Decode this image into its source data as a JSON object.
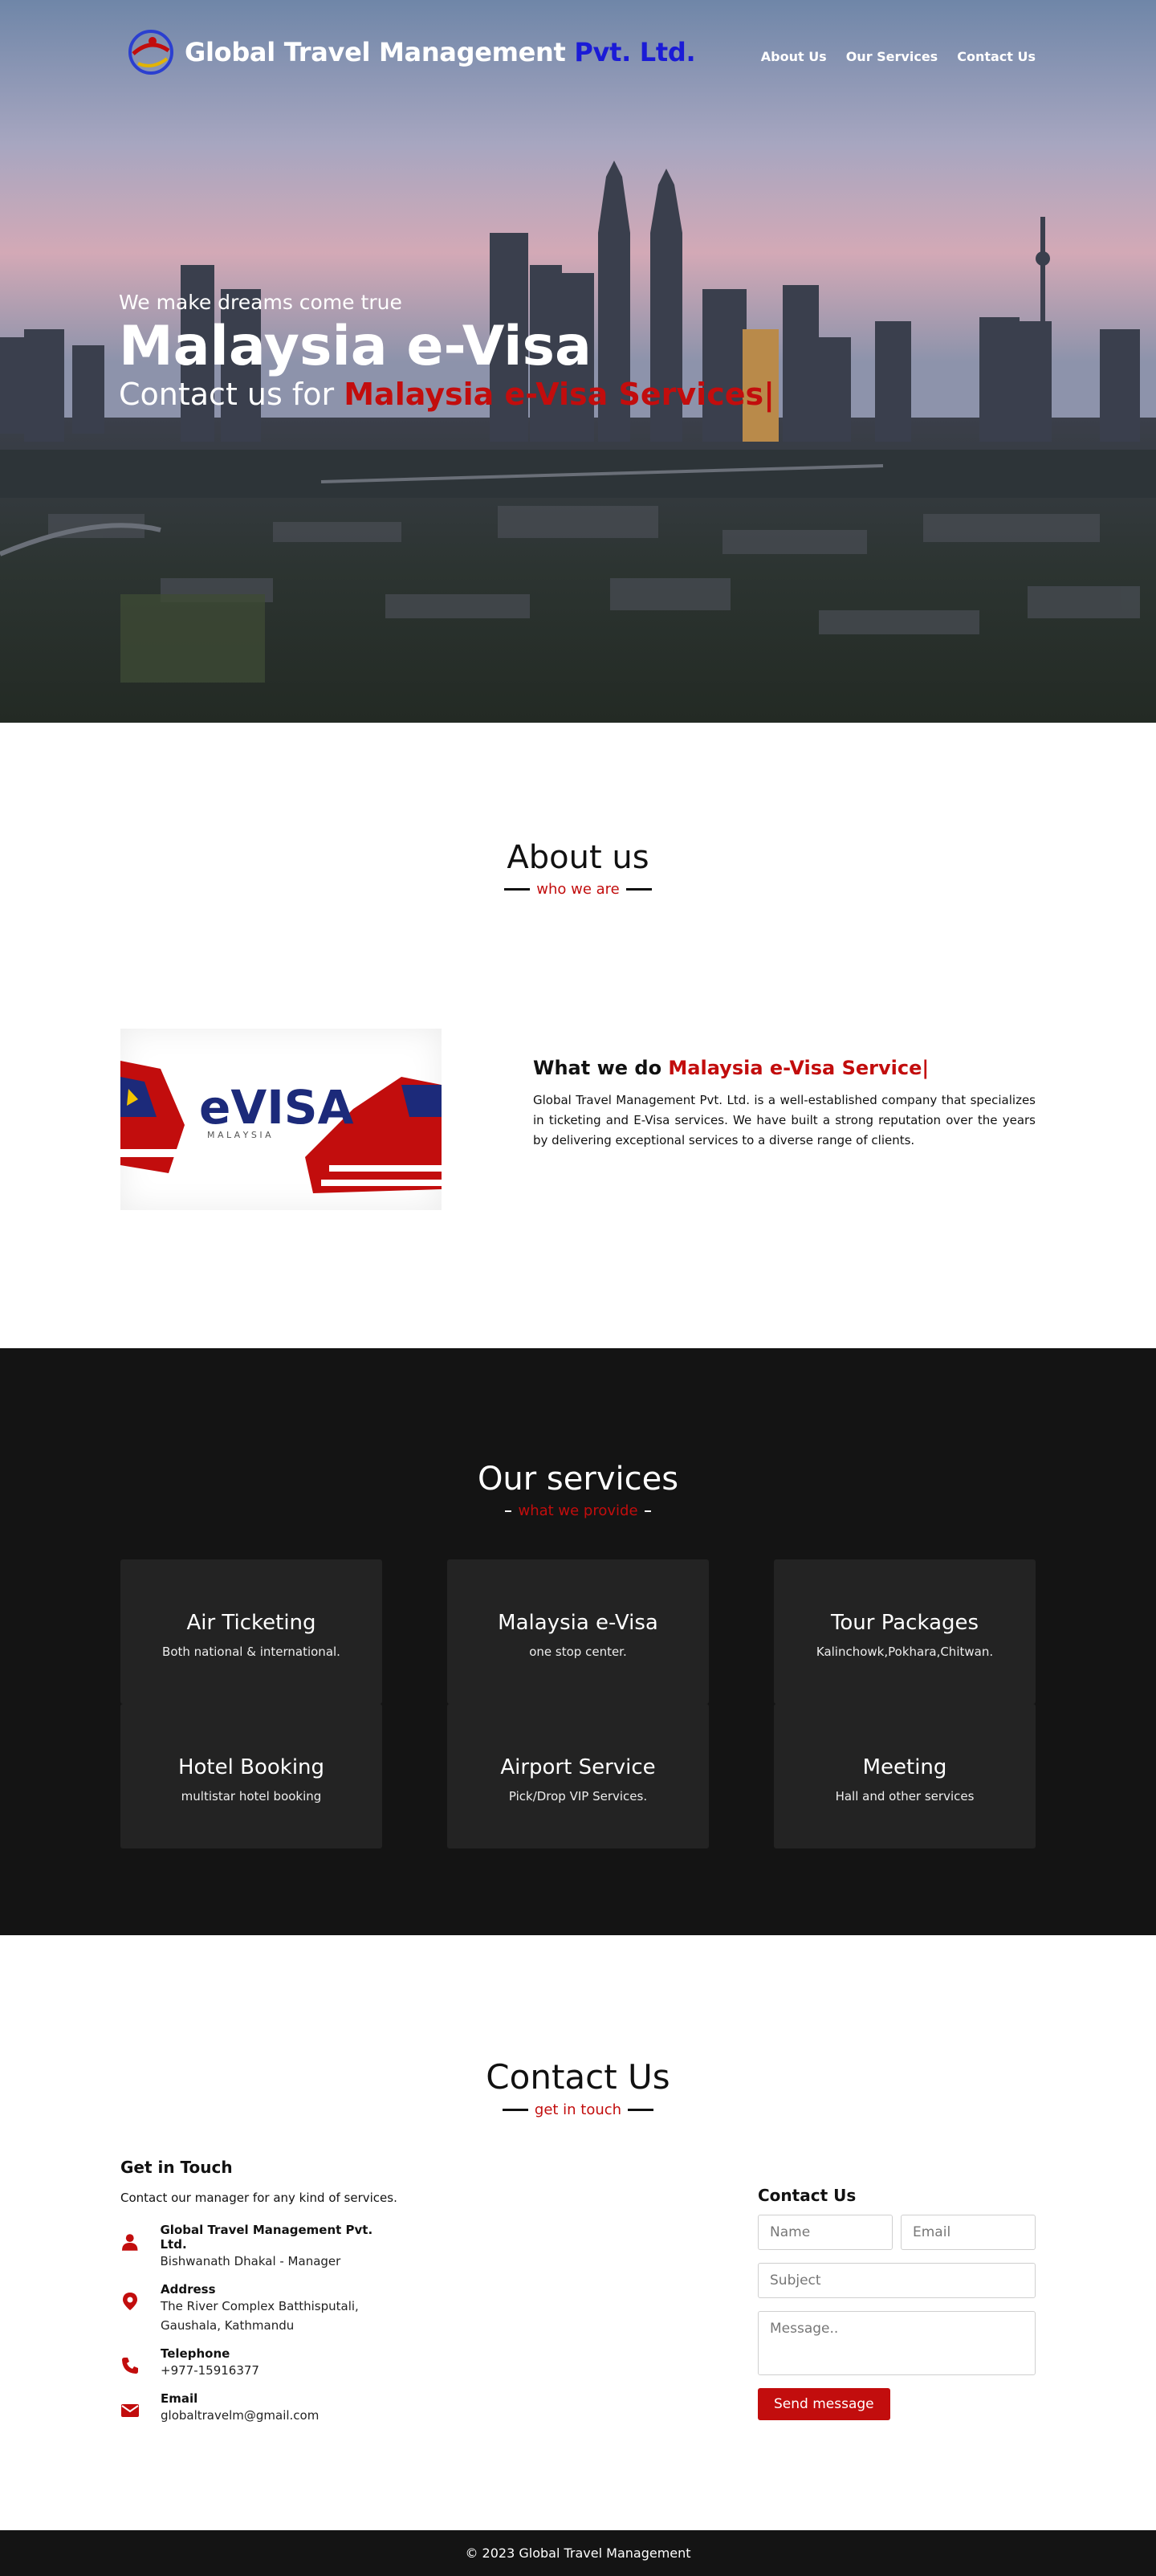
{
  "header": {
    "brand_main": "Global Travel Management",
    "brand_accent": "Pvt. Ltd.",
    "nav": [
      "About Us",
      "Our Services",
      "Contact Us"
    ]
  },
  "hero": {
    "subtitle": "We make dreams come true",
    "title": "Malaysia e-Visa",
    "line_prefix": "Contact us for",
    "line_highlight": "Malaysia e-Visa Services|"
  },
  "about": {
    "heading": "About us",
    "tag": "who we are",
    "image_title": "eVISA",
    "image_sub": "M A L A Y S I A",
    "what_prefix": "What we do",
    "what_highlight": "Malaysia e-Visa Service|",
    "body": "Global Travel Management Pvt. Ltd. is a well-established company that specializes in ticketing and E-Visa services. We have built a strong reputation over the years by delivering exceptional services to a diverse range of clients."
  },
  "services": {
    "heading": "Our services",
    "tag": "what we provide",
    "items": [
      {
        "title": "Air Ticketing",
        "desc": "Both national & international."
      },
      {
        "title": "Malaysia e-Visa",
        "desc": "one stop center."
      },
      {
        "title": "Tour Packages",
        "desc": "Kalinchowk,Pokhara,Chitwan."
      },
      {
        "title": "Hotel Booking",
        "desc": "multistar hotel booking"
      },
      {
        "title": "Airport Service",
        "desc": "Pick/Drop VIP Services."
      },
      {
        "title": "Meeting",
        "desc": "Hall and other services"
      }
    ]
  },
  "contact": {
    "heading": "Contact Us",
    "tag": "get in touch",
    "git_title": "Get in Touch",
    "git_intro": "Contact our manager for any kind of services.",
    "info": [
      {
        "icon": "user-icon",
        "label": "Global Travel Management Pvt. Ltd.",
        "value": "Bishwanath Dhakal - Manager"
      },
      {
        "icon": "map-pin-icon",
        "label": "Address",
        "value": "The River Complex Batthisputali, Gaushala, Kathmandu"
      },
      {
        "icon": "phone-icon",
        "label": "Telephone",
        "value": "+977-15916377"
      },
      {
        "icon": "envelope-icon",
        "label": "Email",
        "value": "globaltravelm@gmail.com"
      }
    ],
    "form": {
      "title": "Contact Us",
      "name_placeholder": "Name",
      "email_placeholder": "Email",
      "subject_placeholder": "Subject",
      "message_placeholder": "Message..",
      "submit_label": "Send message"
    }
  },
  "footer": {
    "text": "© 2023 Global Travel Management"
  },
  "colors": {
    "accent_red": "#c20d0d",
    "brand_blue": "#1b1bd6",
    "dark_bg": "#141414",
    "card_bg": "#232323"
  }
}
